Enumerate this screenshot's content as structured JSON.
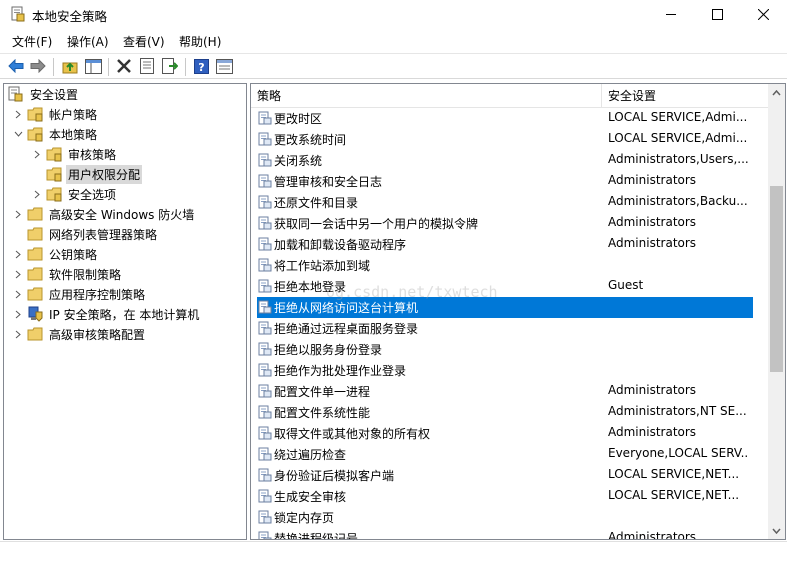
{
  "window": {
    "title": "本地安全策略",
    "colors": {
      "selection": "#0078d7",
      "tree_selection": "#d9d9d9",
      "border": "#828790"
    }
  },
  "menu": [
    {
      "label": "文件(F)"
    },
    {
      "label": "操作(A)"
    },
    {
      "label": "查看(V)"
    },
    {
      "label": "帮助(H)"
    }
  ],
  "toolbar": [
    "back-icon",
    "forward-icon",
    "up-folder-icon",
    "show-hide-tree-icon",
    "delete-icon",
    "properties-icon",
    "export-list-icon",
    "help-icon",
    "console-view-icon"
  ],
  "tree": [
    {
      "label": "安全设置",
      "expanded": true,
      "icon": "security-settings-icon"
    },
    {
      "label": "帐户策略",
      "expanded": false,
      "icon": "folder-icon"
    },
    {
      "label": "本地策略",
      "expanded": true,
      "icon": "folder-icon"
    },
    {
      "label": "审核策略",
      "expanded": false,
      "icon": "folder-icon"
    },
    {
      "label": "用户权限分配",
      "selected": true,
      "icon": "folder-icon"
    },
    {
      "label": "安全选项",
      "expanded": false,
      "icon": "folder-icon"
    },
    {
      "label": "高级安全 Windows 防火墙",
      "expanded": false,
      "icon": "folder-icon"
    },
    {
      "label": "网络列表管理器策略",
      "icon": "folder-icon"
    },
    {
      "label": "公钥策略",
      "expanded": false,
      "icon": "folder-icon"
    },
    {
      "label": "软件限制策略",
      "expanded": false,
      "icon": "folder-icon"
    },
    {
      "label": "应用程序控制策略",
      "expanded": false,
      "icon": "folder-icon"
    },
    {
      "label": "IP 安全策略，在 本地计算机",
      "expanded": false,
      "icon": "ip-security-icon"
    },
    {
      "label": "高级审核策略配置",
      "expanded": false,
      "icon": "folder-icon"
    }
  ],
  "list": {
    "columns": {
      "policy": "策略",
      "setting": "安全设置"
    },
    "rows": [
      {
        "policy": "更改时区",
        "setting": "LOCAL SERVICE,Admi..."
      },
      {
        "policy": "更改系统时间",
        "setting": "LOCAL SERVICE,Admi..."
      },
      {
        "policy": "关闭系统",
        "setting": "Administrators,Users,..."
      },
      {
        "policy": "管理审核和安全日志",
        "setting": "Administrators"
      },
      {
        "policy": "还原文件和目录",
        "setting": "Administrators,Backu..."
      },
      {
        "policy": "获取同一会话中另一个用户的模拟令牌",
        "setting": "Administrators"
      },
      {
        "policy": "加载和卸载设备驱动程序",
        "setting": "Administrators"
      },
      {
        "policy": "将工作站添加到域",
        "setting": ""
      },
      {
        "policy": "拒绝本地登录",
        "setting": "Guest"
      },
      {
        "policy": "拒绝从网络访问这台计算机",
        "setting": "",
        "selected": true
      },
      {
        "policy": "拒绝通过远程桌面服务登录",
        "setting": ""
      },
      {
        "policy": "拒绝以服务身份登录",
        "setting": ""
      },
      {
        "policy": "拒绝作为批处理作业登录",
        "setting": ""
      },
      {
        "policy": "配置文件单一进程",
        "setting": "Administrators"
      },
      {
        "policy": "配置文件系统性能",
        "setting": "Administrators,NT SE..."
      },
      {
        "policy": "取得文件或其他对象的所有权",
        "setting": "Administrators"
      },
      {
        "policy": "绕过遍历检查",
        "setting": "Everyone,LOCAL SERV..."
      },
      {
        "policy": "身份验证后模拟客户端",
        "setting": "LOCAL SERVICE,NET..."
      },
      {
        "policy": "生成安全审核",
        "setting": "LOCAL SERVICE,NET..."
      },
      {
        "policy": "锁定内存页",
        "setting": ""
      },
      {
        "policy": "替换进程级记号",
        "setting": "Administrators"
      }
    ]
  },
  "watermark": "og.csdn.net/txwtech"
}
